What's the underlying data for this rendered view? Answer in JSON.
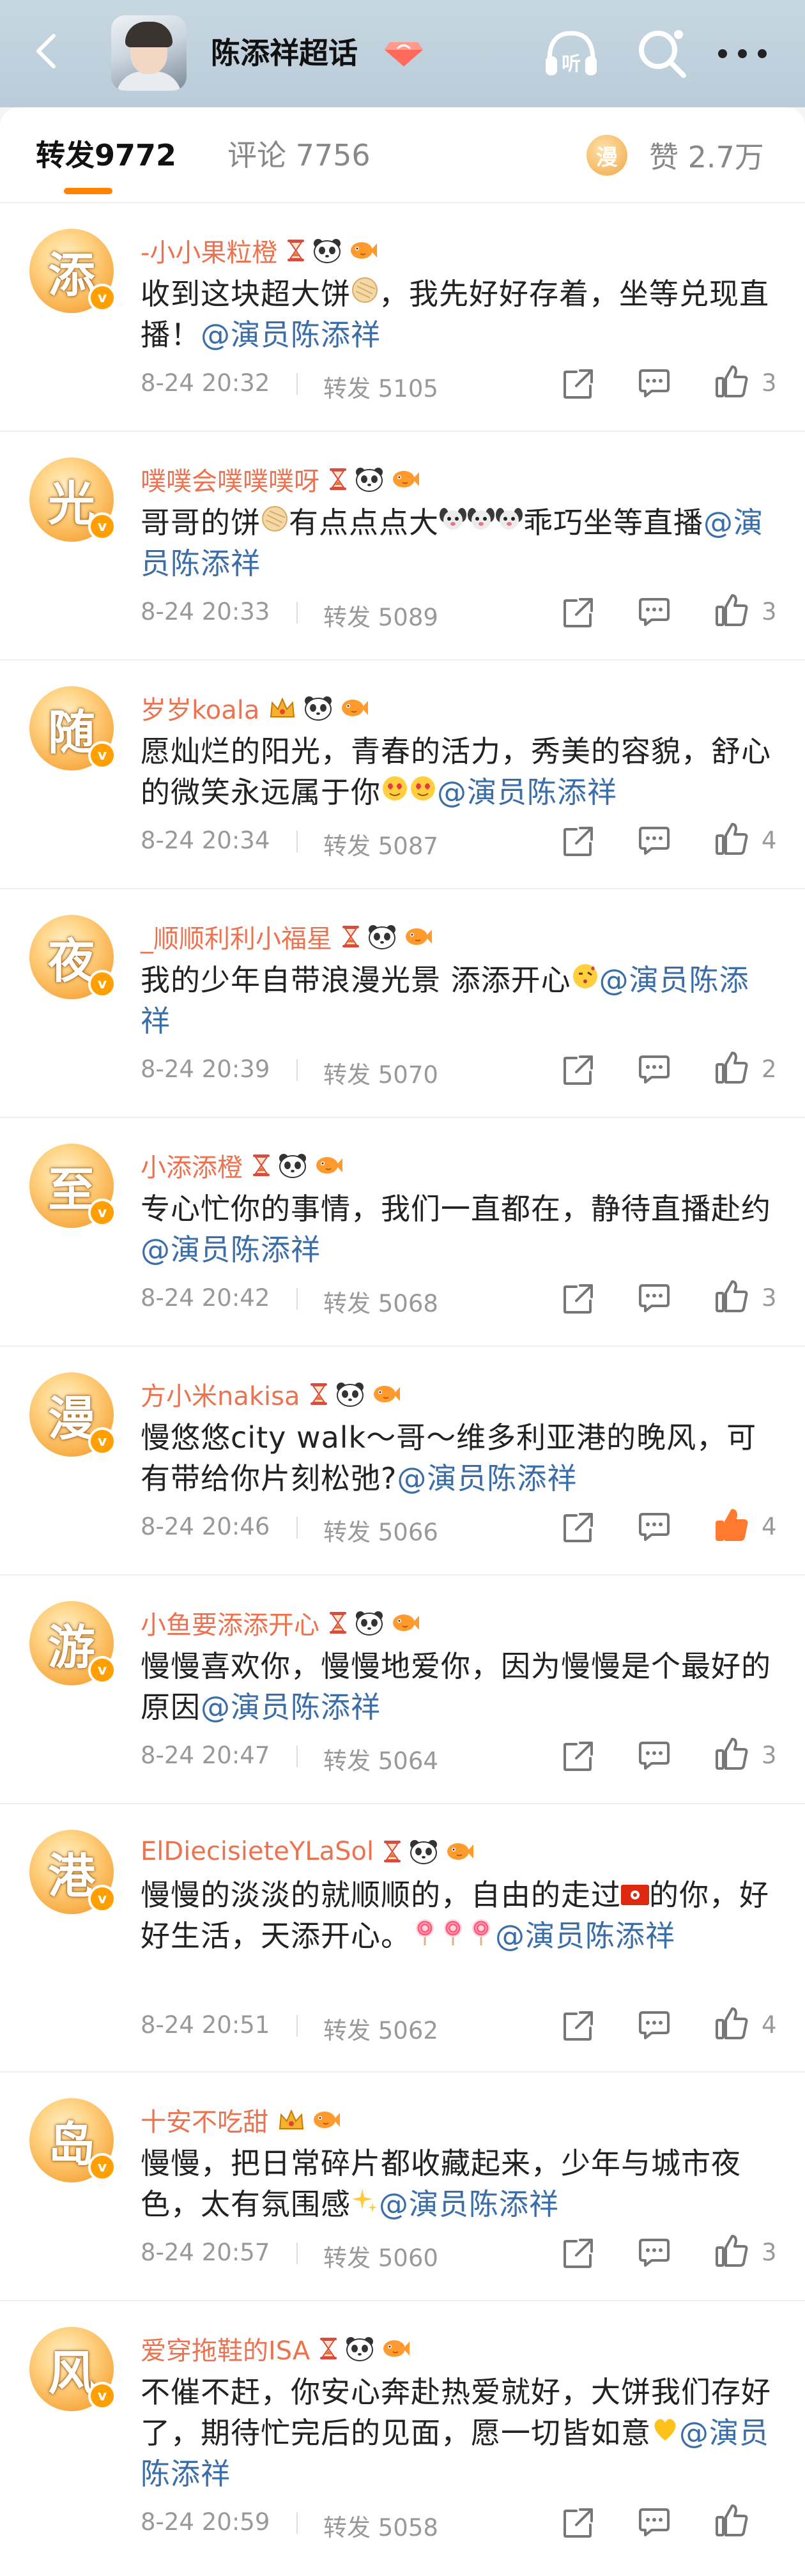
{
  "header": {
    "title": "陈添祥超话",
    "icons": [
      "back-arrow-icon",
      "avatar",
      "super-topic-badge-icon",
      "listen-icon",
      "search-icon",
      "more-icon"
    ]
  },
  "tabs": {
    "repost_label": "转发",
    "repost_count": "9772",
    "comment_label": "评论",
    "comment_count": "7756",
    "like_avatar_char": "漫",
    "like_label": "赞",
    "like_count": "2.7万"
  },
  "colors": {
    "accent": "#ff8200",
    "username": "#eb7350",
    "mention": "#3b6ea8",
    "like_active": "#ff7a2e"
  },
  "posts": [
    {
      "avatar_char": "添",
      "username": "-小小果粒橙",
      "medals": [
        "hourglass-icon",
        "panda-icon",
        "fish-icon"
      ],
      "segments": [
        {
          "t": "收到这块超大饼"
        },
        {
          "e": "cookie"
        },
        {
          "t": "，我先好好存着，坐等兑现直播！"
        },
        {
          "at": "@演员陈添祥"
        }
      ],
      "time": "8-24 20:32",
      "repost": "转发 5105",
      "likes": "3",
      "liked": false
    },
    {
      "avatar_char": "光",
      "username": "噗噗会噗噗噗呀",
      "medals": [
        "hourglass-icon",
        "panda-icon",
        "fish-icon"
      ],
      "segments": [
        {
          "t": "哥哥的饼"
        },
        {
          "e": "cookie"
        },
        {
          "t": "有点点点大"
        },
        {
          "e": "puppy"
        },
        {
          "e": "puppy"
        },
        {
          "e": "puppy"
        },
        {
          "t": "乖巧坐等直播"
        },
        {
          "at": "@演员陈添祥"
        }
      ],
      "time": "8-24 20:33",
      "repost": "转发 5089",
      "likes": "3",
      "liked": false
    },
    {
      "avatar_char": "随",
      "username": "岁岁koala",
      "medals": [
        "crown-icon",
        "panda-icon",
        "fish-icon"
      ],
      "segments": [
        {
          "t": "愿灿烂的阳光，青春的活力，秀美的容貌，舒心的微笑永远属于你"
        },
        {
          "e": "heart-face"
        },
        {
          "e": "heart-face"
        },
        {
          "at": "@演员陈添祥"
        }
      ],
      "time": "8-24 20:34",
      "repost": "转发 5087",
      "likes": "4",
      "liked": false
    },
    {
      "avatar_char": "夜",
      "username": "_顺顺利利小福星",
      "medals": [
        "hourglass-icon",
        "panda-icon",
        "fish-icon"
      ],
      "segments": [
        {
          "t": "我的少年自带浪漫光景 添添开心"
        },
        {
          "e": "kiss"
        },
        {
          "at": "@演员陈添祥"
        }
      ],
      "time": "8-24 20:39",
      "repost": "转发 5070",
      "likes": "2",
      "liked": false
    },
    {
      "avatar_char": "至",
      "username": "小添添橙",
      "medals": [
        "hourglass-icon",
        "panda-icon",
        "fish-icon"
      ],
      "segments": [
        {
          "t": "专心忙你的事情，我们一直都在，静待直播赴约"
        },
        {
          "at": "@演员陈添祥"
        }
      ],
      "time": "8-24 20:42",
      "repost": "转发 5068",
      "likes": "3",
      "liked": false
    },
    {
      "avatar_char": "漫",
      "username": "方小米nakisa",
      "medals": [
        "hourglass-icon",
        "panda-icon",
        "fish-icon"
      ],
      "segments": [
        {
          "t": "慢悠悠city walk～哥～维多利亚港的晚风，可有带给你片刻松弛?"
        },
        {
          "at": "@演员陈添祥"
        }
      ],
      "time": "8-24 20:46",
      "repost": "转发 5066",
      "likes": "4",
      "liked": true
    },
    {
      "avatar_char": "游",
      "username": "小鱼要添添开心",
      "medals": [
        "hourglass-icon",
        "panda-icon",
        "fish-icon"
      ],
      "segments": [
        {
          "t": "慢慢喜欢你，慢慢地爱你，因为慢慢是个最好的原因"
        },
        {
          "at": "@演员陈添祥"
        }
      ],
      "time": "8-24 20:47",
      "repost": "转发 5064",
      "likes": "3",
      "liked": false
    },
    {
      "avatar_char": "港",
      "username": "ElDiecisieteYLaSol",
      "medals": [
        "hourglass-icon",
        "panda-icon",
        "fish-icon"
      ],
      "segments": [
        {
          "t": "慢慢的淡淡的就顺顺的，自由的走过"
        },
        {
          "e": "hk-flag"
        },
        {
          "t": "的你，好好生活，天添开心。"
        },
        {
          "e": "lollipop"
        },
        {
          "e": "lollipop"
        },
        {
          "e": "lollipop"
        },
        {
          "at": "@演员陈添祥"
        }
      ],
      "time": "8-24 20:51",
      "repost": "转发 5062",
      "likes": "4",
      "liked": false
    },
    {
      "avatar_char": "岛",
      "username": "十安不吃甜",
      "medals": [
        "crown-icon",
        "fish-icon"
      ],
      "segments": [
        {
          "t": "慢慢，把日常碎片都收藏起来，少年与城市夜色，太有氛围感"
        },
        {
          "e": "sparkles"
        },
        {
          "at": "@演员陈添祥"
        }
      ],
      "time": "8-24 20:57",
      "repost": "转发 5060",
      "likes": "3",
      "liked": false
    },
    {
      "avatar_char": "风",
      "username": "爱穿拖鞋的ISA",
      "medals": [
        "hourglass-icon",
        "panda-icon",
        "fish-icon"
      ],
      "segments": [
        {
          "t": "不催不赶，你安心奔赴热爱就好，大饼我们存好了，期待忙完后的见面，愿一切皆如意"
        },
        {
          "e": "yellow-heart"
        },
        {
          "at": "@演员陈添祥"
        }
      ],
      "time": "8-24 20:59",
      "repost": "转发 5058",
      "likes": "",
      "liked": false
    }
  ]
}
